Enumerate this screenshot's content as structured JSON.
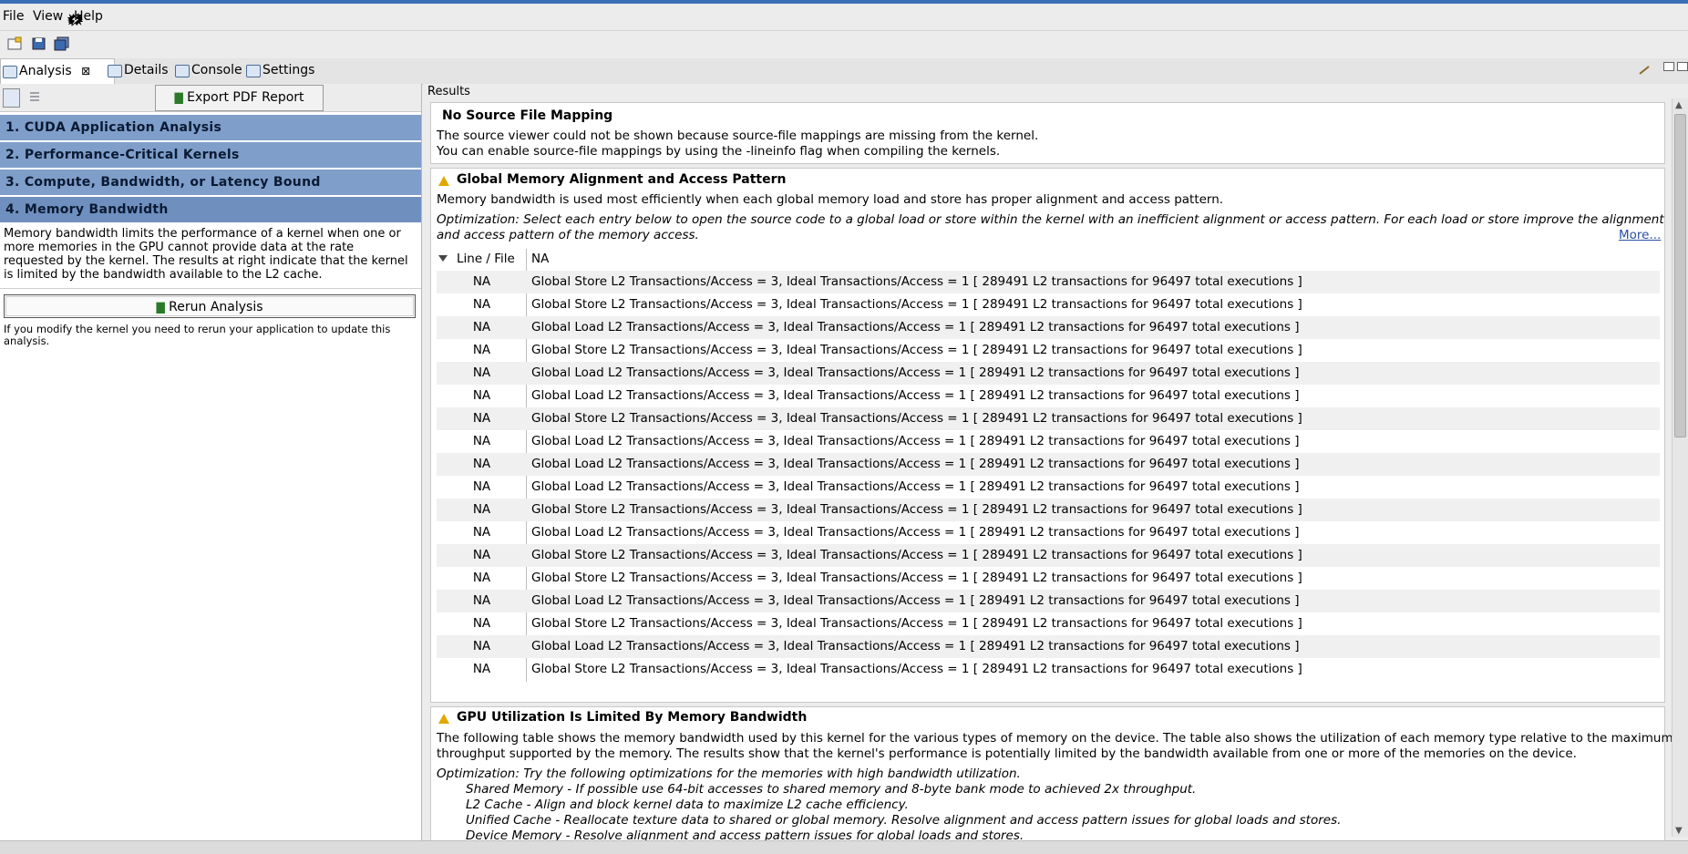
{
  "menu": {
    "file": "File",
    "view": "View",
    "help": "Help"
  },
  "tabs": [
    {
      "label": "Analysis",
      "close": "⊠"
    },
    {
      "label": "Details"
    },
    {
      "label": "Console"
    },
    {
      "label": "Settings"
    }
  ],
  "left": {
    "export_label": "Export PDF Report",
    "sections": [
      "1. CUDA Application Analysis",
      "2. Performance-Critical Kernels",
      "3. Compute, Bandwidth, or Latency Bound",
      "4. Memory Bandwidth"
    ],
    "description": "Memory bandwidth limits the performance of a kernel when one or more memories in the GPU cannot provide data at the rate requested by the kernel. The results at right indicate that the kernel is limited by the bandwidth available to the L2 cache.",
    "rerun_label": "Rerun Analysis",
    "note": "If you modify the kernel you need to rerun your application to update this analysis."
  },
  "results": {
    "label": "Results",
    "no_source": {
      "title": "No Source File Mapping",
      "line1": "The source viewer could not be shown because source-file mappings are missing from the kernel.",
      "line2": "You can enable source-file mappings by using the -lineinfo flag when compiling the kernels."
    },
    "alignment": {
      "title": "Global Memory Alignment and Access Pattern",
      "desc": "Memory bandwidth is used most efficiently when each global memory load and store has proper alignment and access pattern.",
      "opt1": "Optimization: Select each entry below to open the source code to a global load or store within the kernel with an inefficient alignment or access pattern. For each load or store improve the alignment",
      "opt2": "and access pattern of the memory access.",
      "more": "More...",
      "col1": "Line / File",
      "col2": "NA",
      "rows": [
        {
          "line": "NA",
          "text": "Global Store L2 Transactions/Access = 3, Ideal Transactions/Access = 1 [ 289491 L2 transactions for 96497 total executions ]"
        },
        {
          "line": "NA",
          "text": "Global Store L2 Transactions/Access = 3, Ideal Transactions/Access = 1 [ 289491 L2 transactions for 96497 total executions ]"
        },
        {
          "line": "NA",
          "text": "Global Load L2 Transactions/Access = 3, Ideal Transactions/Access = 1 [ 289491 L2 transactions for 96497 total executions ]"
        },
        {
          "line": "NA",
          "text": "Global Store L2 Transactions/Access = 3, Ideal Transactions/Access = 1 [ 289491 L2 transactions for 96497 total executions ]"
        },
        {
          "line": "NA",
          "text": "Global Load L2 Transactions/Access = 3, Ideal Transactions/Access = 1 [ 289491 L2 transactions for 96497 total executions ]"
        },
        {
          "line": "NA",
          "text": "Global Load L2 Transactions/Access = 3, Ideal Transactions/Access = 1 [ 289491 L2 transactions for 96497 total executions ]"
        },
        {
          "line": "NA",
          "text": "Global Store L2 Transactions/Access = 3, Ideal Transactions/Access = 1 [ 289491 L2 transactions for 96497 total executions ]"
        },
        {
          "line": "NA",
          "text": "Global Load L2 Transactions/Access = 3, Ideal Transactions/Access = 1 [ 289491 L2 transactions for 96497 total executions ]"
        },
        {
          "line": "NA",
          "text": "Global Load L2 Transactions/Access = 3, Ideal Transactions/Access = 1 [ 289491 L2 transactions for 96497 total executions ]"
        },
        {
          "line": "NA",
          "text": "Global Load L2 Transactions/Access = 3, Ideal Transactions/Access = 1 [ 289491 L2 transactions for 96497 total executions ]"
        },
        {
          "line": "NA",
          "text": "Global Store L2 Transactions/Access = 3, Ideal Transactions/Access = 1 [ 289491 L2 transactions for 96497 total executions ]"
        },
        {
          "line": "NA",
          "text": "Global Load L2 Transactions/Access = 3, Ideal Transactions/Access = 1 [ 289491 L2 transactions for 96497 total executions ]"
        },
        {
          "line": "NA",
          "text": "Global Store L2 Transactions/Access = 3, Ideal Transactions/Access = 1 [ 289491 L2 transactions for 96497 total executions ]"
        },
        {
          "line": "NA",
          "text": "Global Store L2 Transactions/Access = 3, Ideal Transactions/Access = 1 [ 289491 L2 transactions for 96497 total executions ]"
        },
        {
          "line": "NA",
          "text": "Global Load L2 Transactions/Access = 3, Ideal Transactions/Access = 1 [ 289491 L2 transactions for 96497 total executions ]"
        },
        {
          "line": "NA",
          "text": "Global Store L2 Transactions/Access = 3, Ideal Transactions/Access = 1 [ 289491 L2 transactions for 96497 total executions ]"
        },
        {
          "line": "NA",
          "text": "Global Load L2 Transactions/Access = 3, Ideal Transactions/Access = 1 [ 289491 L2 transactions for 96497 total executions ]"
        },
        {
          "line": "NA",
          "text": "Global Store L2 Transactions/Access = 3, Ideal Transactions/Access = 1 [ 289491 L2 transactions for 96497 total executions ]"
        }
      ]
    },
    "gpu": {
      "title": "GPU Utilization Is Limited By Memory Bandwidth",
      "desc1": "The following table shows the memory bandwidth used by this kernel for the various types of memory on the device. The table also shows the utilization of each memory type relative to the maximum",
      "desc2": "throughput supported by the memory. The results show that the kernel's performance is potentially limited by the bandwidth available from one or more of the memories on the device.",
      "opt": "Optimization: Try the following optimizations for the memories with high bandwidth utilization.",
      "items": [
        "Shared Memory - If possible use 64-bit accesses to shared memory and 8-byte bank mode to achieved 2x throughput.",
        "L2 Cache - Align and block kernel data to maximize L2 cache efficiency.",
        "Unified Cache - Reallocate texture data to shared or global memory. Resolve alignment and access pattern issues for global loads and stores.",
        "Device Memory - Resolve alignment and access pattern issues for global loads and stores."
      ]
    }
  }
}
